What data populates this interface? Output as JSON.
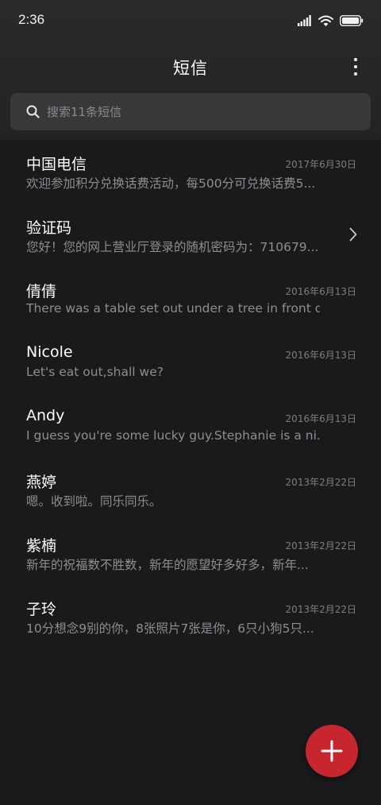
{
  "status_bar": {
    "time": "2:36"
  },
  "header": {
    "title": "短信"
  },
  "search": {
    "placeholder": "搜索11条短信"
  },
  "conversations": [
    {
      "name": "中国电信",
      "date": "2017年6月30日",
      "preview": "欢迎参加积分兑换话费活动，每500分可兑换话费5..."
    },
    {
      "name": "验证码",
      "date": "",
      "preview": "您好！您的网上营业厅登录的随机密码为：710679..."
    },
    {
      "name": "倩倩",
      "date": "2016年6月13日",
      "preview": "There was a table set out under a tree in front of ..."
    },
    {
      "name": "Nicole",
      "date": "2016年6月13日",
      "preview": "Let's eat out,shall we?"
    },
    {
      "name": "Andy",
      "date": "2016年6月13日",
      "preview": "I guess you're some lucky guy.Stephanie is a ni..."
    },
    {
      "name": "燕婷",
      "date": "2013年2月22日",
      "preview": "嗯。收到啦。同乐同乐。"
    },
    {
      "name": "紫楠",
      "date": "2013年2月22日",
      "preview": "新年的祝福数不胜数，新年的愿望好多好多，新年..."
    },
    {
      "name": "子玲",
      "date": "2013年2月22日",
      "preview": "10分想念9别的你，8张照片7张是你，6只小狗5只..."
    }
  ],
  "icons": {
    "status": [
      "signal-icon",
      "wifi-icon",
      "battery-icon"
    ],
    "search": "search-icon",
    "more": "more-vertical-icon",
    "chevron": "chevron-right-icon",
    "fab": "plus-icon"
  },
  "colors": {
    "background": "#1a1a1c",
    "header": "#2a2a2c",
    "search_box": "#38383b",
    "fab": "#c8262e",
    "primary_text": "#ffffff",
    "secondary_text": "#8e8e91",
    "date_text": "#7d7d80"
  }
}
